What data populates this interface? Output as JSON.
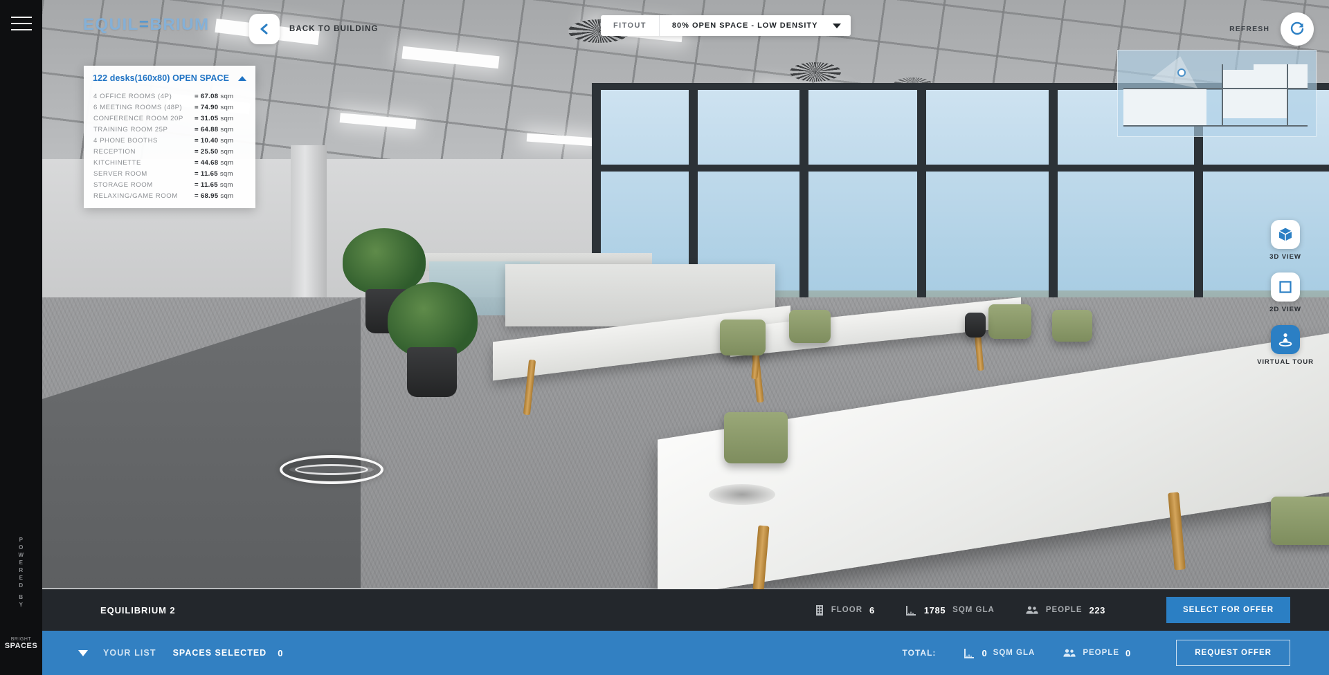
{
  "brand": {
    "name_left": "EQUIL",
    "dash": "=",
    "name_right": "BRIUM"
  },
  "rail": {
    "menu_icon": "hamburger-icon",
    "powered_by": [
      "P",
      "O",
      "W",
      "E",
      "R",
      "E",
      "D",
      " ",
      "B",
      "Y"
    ],
    "powered_text": "POWERED BY",
    "logo_top": "BRIGHT",
    "logo_main": "SPACES"
  },
  "topbar": {
    "back_label": "BACK TO BUILDING",
    "back_icon": "chevron-left-icon",
    "fitout_tag": "FITOUT",
    "fitout_selected": "80% OPEN SPACE - LOW DENSITY",
    "fitout_caret": "chevron-down-icon",
    "refresh_label": "REFRESH",
    "refresh_icon": "refresh-icon"
  },
  "info_panel": {
    "title": "122 desks(160x80) OPEN SPACE",
    "collapse_icon": "chevron-up-icon",
    "rows": [
      {
        "label": "4 OFFICE ROOMS (4P)",
        "value": "= 67.08",
        "unit": "sqm"
      },
      {
        "label": "6 MEETING ROOMS (48P)",
        "value": "= 74.90",
        "unit": "sqm"
      },
      {
        "label": "CONFERENCE ROOM 20P",
        "value": "= 31.05",
        "unit": "sqm"
      },
      {
        "label": "TRAINING ROOM 25P",
        "value": "= 64.88",
        "unit": "sqm"
      },
      {
        "label": "4 PHONE BOOTHS",
        "value": "= 10.40",
        "unit": "sqm"
      },
      {
        "label": "RECEPTION",
        "value": "= 25.50",
        "unit": "sqm"
      },
      {
        "label": "KITCHINETTE",
        "value": "= 44.68",
        "unit": "sqm"
      },
      {
        "label": "SERVER ROOM",
        "value": "= 11.65",
        "unit": "sqm"
      },
      {
        "label": "STORAGE ROOM",
        "value": "= 11.65",
        "unit": "sqm"
      },
      {
        "label": "RELAXING/GAME ROOM",
        "value": "= 68.95",
        "unit": "sqm"
      }
    ]
  },
  "view_modes": [
    {
      "label": "3D VIEW",
      "icon": "cube-icon",
      "active": false
    },
    {
      "label": "2D VIEW",
      "icon": "square-icon",
      "active": false
    },
    {
      "label": "VIRTUAL TOUR",
      "icon": "person-360-icon",
      "active": true
    }
  ],
  "dark_bar": {
    "title": "EQUILIBRIUM 2",
    "floor_icon": "building-icon",
    "floor_label": "FLOOR",
    "floor_value": "6",
    "area_icon": "ruler-icon",
    "area_value": "1785",
    "area_label": "SQM GLA",
    "people_icon": "people-icon",
    "people_label": "PEOPLE",
    "people_value": "223",
    "select_button": "SELECT FOR OFFER"
  },
  "blue_bar": {
    "caret_icon": "chevron-down-icon",
    "your_list": "YOUR LIST",
    "spaces_selected": "SPACES SELECTED",
    "spaces_count": "0",
    "total_label": "TOTAL:",
    "area_icon": "ruler-icon",
    "area_value": "0",
    "area_label": "SQM GLA",
    "people_icon": "people-icon",
    "people_label": "PEOPLE",
    "people_value": "0",
    "request_button": "REQUEST OFFER"
  },
  "minimap": {
    "name": "floor-plan-minimap",
    "marker": "camera-position-marker"
  },
  "colors": {
    "accent_blue": "#2b7fc4",
    "bar_blue": "#3280c2",
    "dark_bar": "#23272c",
    "rail_black": "#0e0f11",
    "info_title_blue": "#1f73c4"
  }
}
